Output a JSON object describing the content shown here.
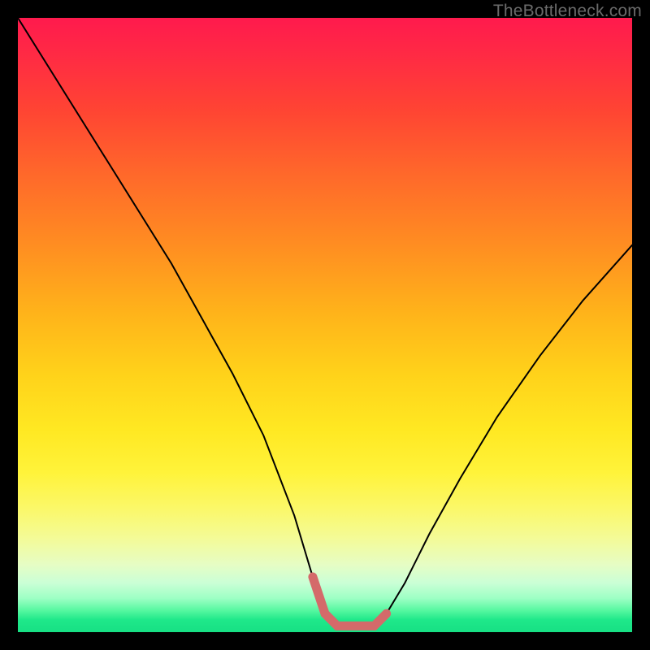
{
  "watermark": "TheBottleneck.com",
  "chart_data": {
    "type": "line",
    "title": "",
    "xlabel": "",
    "ylabel": "",
    "xlim": [
      0,
      100
    ],
    "ylim": [
      0,
      100
    ],
    "grid": false,
    "series": [
      {
        "name": "bottleneck-curve",
        "x": [
          0,
          5,
          10,
          15,
          20,
          25,
          30,
          35,
          40,
          45,
          48,
          50,
          52,
          54,
          56,
          58,
          60,
          63,
          67,
          72,
          78,
          85,
          92,
          100
        ],
        "values": [
          100,
          92,
          84,
          76,
          68,
          60,
          51,
          42,
          32,
          19,
          9,
          3,
          1,
          1,
          1,
          1,
          3,
          8,
          16,
          25,
          35,
          45,
          54,
          63
        ]
      },
      {
        "name": "highlight-band",
        "x": [
          48,
          50,
          52,
          54,
          56,
          58,
          60
        ],
        "values": [
          9,
          3,
          1,
          1,
          1,
          1,
          3
        ]
      }
    ],
    "colors": {
      "curve": "#000000",
      "highlight": "#d46a6a",
      "gradient_top": "#ff1a4d",
      "gradient_mid": "#ffe822",
      "gradient_bottom": "#17e084"
    }
  }
}
